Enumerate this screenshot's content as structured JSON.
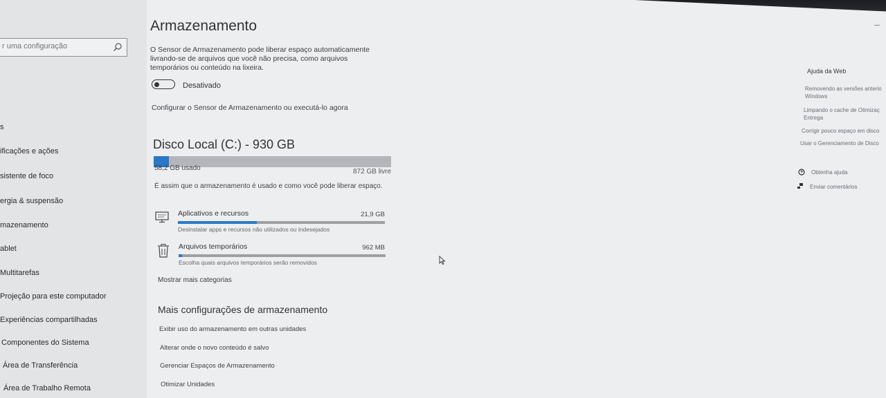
{
  "sidebar": {
    "search_placeholder": "r uma configuração",
    "items": [
      {
        "label": "s"
      },
      {
        "label": "ificações e ações"
      },
      {
        "label": "sistente de foco"
      },
      {
        "label": "ergia & suspensão"
      },
      {
        "label": "mazenamento"
      },
      {
        "label": "ablet"
      },
      {
        "label": "Multitarefas"
      },
      {
        "label": "Projeção para este computador"
      },
      {
        "label": "Experiências compartilhadas"
      },
      {
        "label": "Componentes do Sistema"
      },
      {
        "label": "Área de Transferência"
      },
      {
        "label": "Área de Trabalho Remota"
      }
    ]
  },
  "main": {
    "title": "Armazenamento",
    "description": "O Sensor de Armazenamento pode liberar espaço automaticamente livrando-se de arquivos que você não precisa, como arquivos temporários ou conteúdo na lixeira.",
    "toggle_label": "Desativado",
    "toggle_on": false,
    "config_link": "Configurar o Sensor de Armazenamento ou executá-lo agora",
    "disk": {
      "title": "Disco Local (C:) - 930 GB",
      "used_label": "58,2 GB usado",
      "free_label": "872 GB livre",
      "used_fraction": 0.063,
      "description": "É assim que o armazenamento é usado e como você pode liberar espaço."
    },
    "categories": [
      {
        "name": "Aplicativos e recursos",
        "size": "21,9 GB",
        "sub": "Desinstalar apps e recursos não utilizados ou indesejados",
        "fraction": 0.38,
        "icon": "monitor-icon"
      },
      {
        "name": "Arquivos temporários",
        "size": "962 MB",
        "sub": "Escolha quais arquivos temporários serão removidos",
        "fraction": 0.017,
        "icon": "trash-icon"
      }
    ],
    "show_more": "Mostrar mais categorias",
    "more_title": "Mais configurações de armazenamento",
    "more_links": [
      "Exibir uso do armazenamento em outras unidades",
      "Alterar onde o novo conteúdo é salvo",
      "Gerenciar Espaços de Armazenamento",
      "Otimizar Unidades"
    ]
  },
  "help": {
    "title": "Ajuda da Web",
    "links": [
      "Removendo as versões anterio Windows",
      "Limpando o cache de Otimizaç Entrega",
      "Corrigir pouco espaço em disco",
      "Usar o Gerenciamento de Disco"
    ],
    "get_help": "Obtenha ajuda",
    "feedback": "Enviar comentários"
  },
  "colors": {
    "accent": "#2a78c8",
    "bar_track": "#b5b6b9",
    "sidebar_bg": "#e3e4e6",
    "page_bg": "#eceef0"
  }
}
